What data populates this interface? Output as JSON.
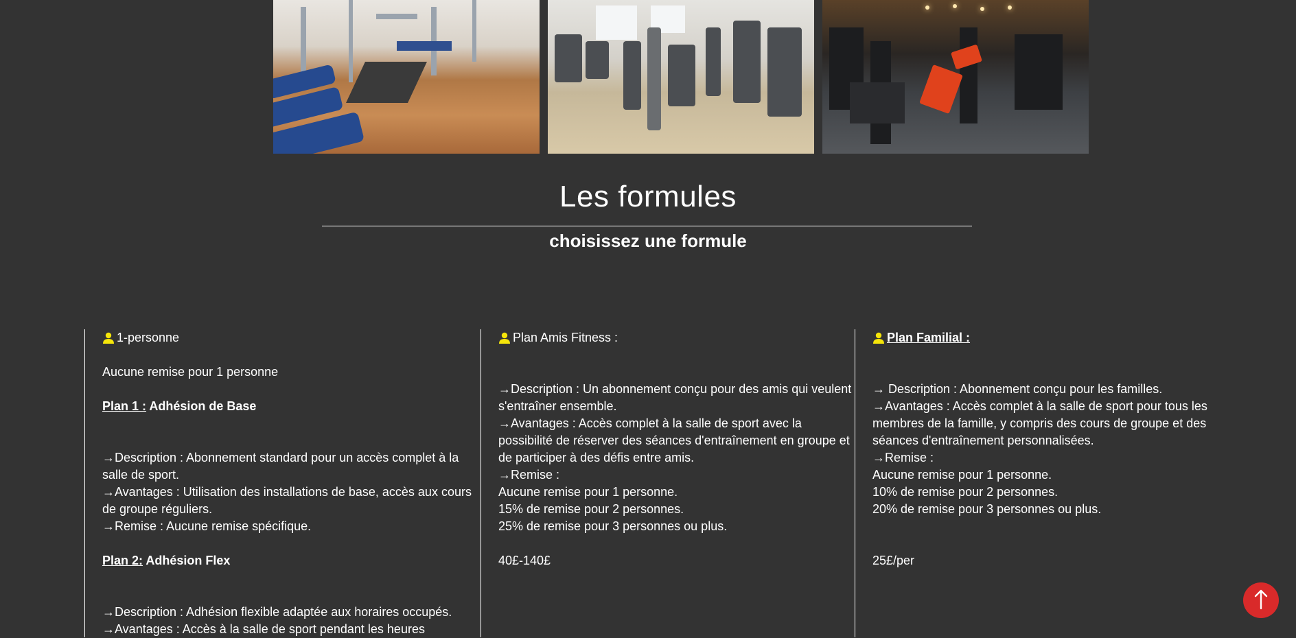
{
  "gallery": {
    "images": [
      {
        "name": "gym-photo-strength"
      },
      {
        "name": "gym-photo-cardio"
      },
      {
        "name": "gym-photo-weights"
      }
    ]
  },
  "header": {
    "title": "Les formules",
    "subtitle": "choisissez une formule"
  },
  "colors": {
    "background": "#333333",
    "text": "#ffffff",
    "icon": "#f5e50a",
    "scroll_button": "#d92a2a"
  },
  "columns": {
    "solo": {
      "heading": "1-personne",
      "note": "Aucune remise pour 1 personne",
      "plan1": {
        "prefix": "Plan 1 :",
        "name": " Adhésion de Base",
        "description": "→Description : Abonnement standard pour un accès complet à la salle de sport.",
        "advantages": "→Avantages : Utilisation des installations de base, accès aux cours de groupe réguliers.",
        "discount": "→Remise : Aucune remise spécifique."
      },
      "plan2": {
        "prefix": "Plan 2:",
        "name": " Adhésion Flex",
        "description": "→Description : Adhésion flexible adaptée aux horaires occupés.",
        "advantages": "→Avantages : Accès à la salle de sport pendant les heures"
      }
    },
    "friends": {
      "heading": "Plan Amis Fitness :",
      "description": "→Description : Un abonnement conçu pour des amis qui veulent s'entraîner ensemble.",
      "advantages": "→Avantages : Accès complet à la salle de sport avec la possibilité de réserver des séances d'entraînement en groupe et de participer à des défis entre amis.",
      "discount_label": "→Remise :",
      "discounts": [
        "Aucune remise pour 1 personne.",
        "15% de remise pour 2 personnes.",
        "25% de remise pour 3 personnes ou plus."
      ],
      "price": "40£-140£"
    },
    "family": {
      "heading": "Plan Familial :",
      "description": "→ Description : Abonnement conçu pour les familles.",
      "advantages": "→Avantages : Accès complet à la salle de sport pour tous les membres de la famille, y compris des cours de groupe et des séances d'entraînement personnalisées.",
      "discount_label": "→Remise :",
      "discounts": [
        "Aucune remise pour 1 personne.",
        "10% de remise pour 2 personnes.",
        "20% de remise pour 3 personnes ou plus."
      ],
      "price": "25£/per"
    }
  },
  "scroll_button": {
    "icon": "arrow-up-icon"
  }
}
